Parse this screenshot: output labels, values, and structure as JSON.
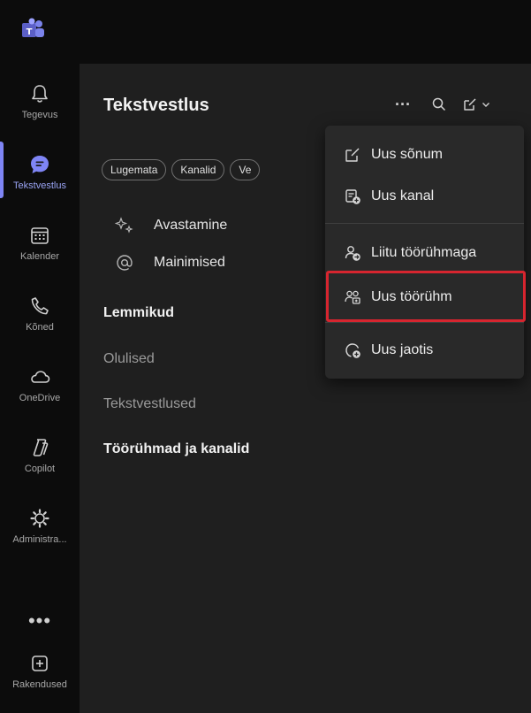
{
  "rail": {
    "items": [
      {
        "label": "Tegevus",
        "icon": "bell-icon"
      },
      {
        "label": "Tekstvestlus",
        "icon": "chat-icon"
      },
      {
        "label": "Kalender",
        "icon": "calendar-icon"
      },
      {
        "label": "Kõned",
        "icon": "phone-icon"
      },
      {
        "label": "OneDrive",
        "icon": "cloud-icon"
      },
      {
        "label": "Copilot",
        "icon": "copilot-icon"
      },
      {
        "label": "Administra...",
        "icon": "admin-icon"
      },
      {
        "label": "Rakendused",
        "icon": "apps-icon"
      }
    ],
    "more": "•••"
  },
  "panel": {
    "title": "Tekstvestlus",
    "more_label": "···",
    "filters": [
      "Lugemata",
      "Kanalid",
      "Ve"
    ],
    "quick": [
      {
        "label": "Avastamine",
        "icon": "discover-icon"
      },
      {
        "label": "Mainimised",
        "icon": "mention-icon"
      }
    ],
    "sections": [
      {
        "label": "Lemmikud"
      },
      {
        "label": "Olulised"
      },
      {
        "label": "Tekstvestlused"
      },
      {
        "label": "Töörühmad ja kanalid"
      }
    ]
  },
  "menu": {
    "items": [
      {
        "label": "Uus sõnum",
        "icon": "compose-icon"
      },
      {
        "label": "Uus kanal",
        "icon": "new-channel-icon"
      },
      {
        "label": "Liitu töörühmaga",
        "icon": "join-team-icon"
      },
      {
        "label": "Uus töörühm",
        "icon": "new-team-icon"
      },
      {
        "label": "Uus jaotis",
        "icon": "new-section-icon"
      }
    ],
    "highlighted": "Uus töörühm"
  },
  "colors": {
    "accent": "#7f85f5",
    "highlight_border": "#d6252f",
    "background": "#1f1f1f",
    "rail": "#0c0c0c",
    "menu": "#292929"
  }
}
